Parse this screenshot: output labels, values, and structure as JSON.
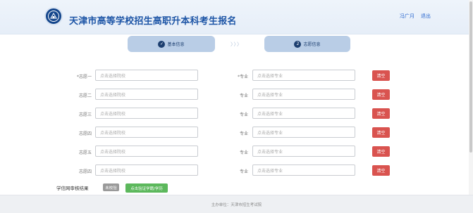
{
  "header": {
    "title": "天津市高等学校招生高职升本科考生报名",
    "user_name": "冯广月",
    "logout_label": "退出"
  },
  "steps": [
    {
      "label": "基本信息",
      "marker": "✓"
    },
    {
      "label": "志愿信息",
      "marker": "2"
    }
  ],
  "steps_separator": "〉〉〉",
  "choices": [
    {
      "label": "*志愿一",
      "school_placeholder": "点击选择院校",
      "major_label": "*专业",
      "major_placeholder": "点击选择专业",
      "clear_label": "清空"
    },
    {
      "label": "志愿二",
      "school_placeholder": "点击选择院校",
      "major_label": "专业",
      "major_placeholder": "点击选择专业",
      "clear_label": "清空"
    },
    {
      "label": "志愿三",
      "school_placeholder": "点击选择院校",
      "major_label": "专业",
      "major_placeholder": "点击选择专业",
      "clear_label": "清空"
    },
    {
      "label": "志愿四",
      "school_placeholder": "点击选择院校",
      "major_label": "专业",
      "major_placeholder": "点击选择专业",
      "clear_label": "清空"
    },
    {
      "label": "志愿五",
      "school_placeholder": "点击选择院校",
      "major_label": "专业",
      "major_placeholder": "点击选择专业",
      "clear_label": "清空"
    },
    {
      "label": "志愿四",
      "school_placeholder": "点击选择院校",
      "major_label": "专业",
      "major_placeholder": "点击选择专业",
      "clear_label": "清空"
    }
  ],
  "verification": {
    "label": "学信网审核结果",
    "status": "未校验",
    "button_label": "点击验证学籍/学历"
  },
  "footer": {
    "text": "主办单位：天津市招生考试院"
  },
  "colors": {
    "brand_blue": "#1d55a6",
    "step_bg": "#b9cde6",
    "clear_red": "#d9534f",
    "verify_green": "#5cb85c",
    "status_gray": "#9a9a9a"
  },
  "icons": {
    "logo": "university-logo-icon",
    "step1": "check-circle-icon",
    "step2": "number-circle-icon",
    "separator": "chevrons-right-icon"
  }
}
